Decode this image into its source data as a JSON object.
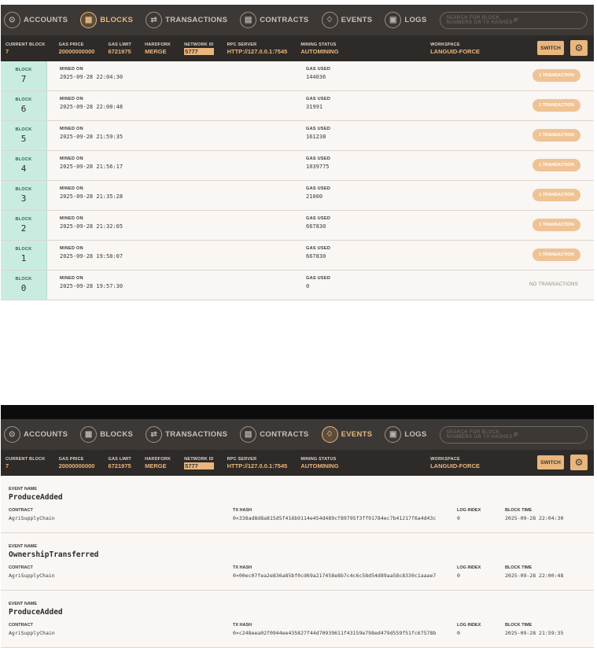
{
  "nav": {
    "accounts": "ACCOUNTS",
    "blocks": "BLOCKS",
    "transactions": "TRANSACTIONS",
    "contracts": "CONTRACTS",
    "events": "EVENTS",
    "logs": "LOGS",
    "search_placeholder": "SEARCH FOR BLOCK NUMBERS OR TX HASHES"
  },
  "status": {
    "current_block_label": "CURRENT BLOCK",
    "current_block": "7",
    "gas_price_label": "GAS PRICE",
    "gas_price": "20000000000",
    "gas_limit_label": "GAS LIMIT",
    "gas_limit": "6721975",
    "hardfork_label": "HARDFORK",
    "hardfork": "MERGE",
    "network_id_label": "NETWORK ID",
    "network_id": "5777",
    "rpc_server_label": "RPC SERVER",
    "rpc_server": "HTTP://127.0.0.1:7545",
    "mining_status_label": "MINING STATUS",
    "mining_status": "AUTOMINING",
    "workspace_label": "WORKSPACE",
    "workspace": "LANGUID-FORCE",
    "switch_label": "SWITCH"
  },
  "labels": {
    "block": "BLOCK",
    "mined_on": "MINED ON",
    "gas_used": "GAS USED",
    "event_name": "EVENT NAME",
    "contract": "CONTRACT",
    "tx_hash": "TX HASH",
    "log_index": "LOG INDEX",
    "block_time": "BLOCK TIME"
  },
  "blocks": [
    {
      "number": "7",
      "mined_on": "2025-09-28 22:04:30",
      "gas_used": "144036",
      "tx": "1 TRANSACTION"
    },
    {
      "number": "6",
      "mined_on": "2025-09-28 22:00:48",
      "gas_used": "31991",
      "tx": "1 TRANSACTION"
    },
    {
      "number": "5",
      "mined_on": "2025-09-28 21:59:35",
      "gas_used": "161238",
      "tx": "1 TRANSACTION"
    },
    {
      "number": "4",
      "mined_on": "2025-09-28 21:56:17",
      "gas_used": "1039775",
      "tx": "1 TRANSACTION"
    },
    {
      "number": "3",
      "mined_on": "2025-09-28 21:35:28",
      "gas_used": "21000",
      "tx": "1 TRANSACTION"
    },
    {
      "number": "2",
      "mined_on": "2025-09-28 21:32:05",
      "gas_used": "667830",
      "tx": "1 TRANSACTION"
    },
    {
      "number": "1",
      "mined_on": "2025-09-28 19:58:07",
      "gas_used": "667830",
      "tx": "1 TRANSACTION"
    },
    {
      "number": "0",
      "mined_on": "2025-09-28 19:57:30",
      "gas_used": "0",
      "tx": "NO TRANSACTIONS"
    }
  ],
  "events": [
    {
      "name": "ProduceAdded",
      "contract": "AgriSupplyChain",
      "tx_hash": "0×338ad8d8a815d5f416b9114e454d489cf89795f3ff91784ec7b41217f6a4d43c",
      "log_index": "0",
      "block_time": "2025-09-28 22:04:30"
    },
    {
      "name": "OwnershipTransferred",
      "contract": "AgriSupplyChain",
      "tx_hash": "0×00ec07fea2e836a85bf0cd69a217458e8b7c4c6c58d54d89aa58c8330c1aaae7",
      "log_index": "0",
      "block_time": "2025-09-28 22:00:48"
    },
    {
      "name": "ProduceAdded",
      "contract": "AgriSupplyChain",
      "tx_hash": "0×c248eea02f0944ee435827f44d70939611f43159e798ed479d559f51fc67578b",
      "log_index": "0",
      "block_time": "2025-09-28 21:59:35"
    }
  ]
}
